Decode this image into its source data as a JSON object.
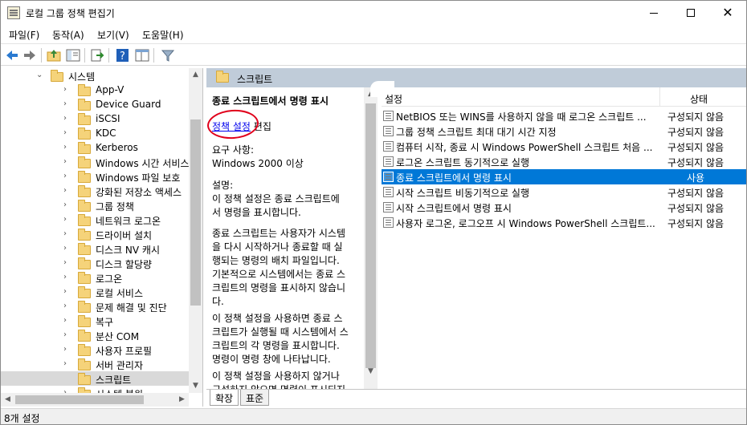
{
  "window": {
    "title": "로컬 그룹 정책 편집기",
    "min_glyph": "",
    "max_glyph": "",
    "close_glyph": "✕"
  },
  "menu": {
    "items": [
      "파일(F)",
      "동작(A)",
      "보기(V)",
      "도움말(H)"
    ]
  },
  "toolbar": {
    "buttons": [
      "back-arrow-icon",
      "forward-arrow-icon",
      "up-folder-icon",
      "show-hide-tree-icon",
      "export-list-icon",
      "help-icon",
      "show-pane-icon",
      "filter-icon"
    ]
  },
  "tree": {
    "items": [
      {
        "label": "시스템",
        "expanded": true
      },
      {
        "label": "App-V"
      },
      {
        "label": "Device Guard"
      },
      {
        "label": "iSCSI"
      },
      {
        "label": "KDC"
      },
      {
        "label": "Kerberos"
      },
      {
        "label": "Windows 시간 서비스"
      },
      {
        "label": "Windows 파일 보호"
      },
      {
        "label": "강화된 저장소 액세스"
      },
      {
        "label": "그룹 정책"
      },
      {
        "label": "네트워크 로그온"
      },
      {
        "label": "드라이버 설치"
      },
      {
        "label": "디스크 NV 캐시"
      },
      {
        "label": "디스크 할당량"
      },
      {
        "label": "로그온"
      },
      {
        "label": "로컬 서비스"
      },
      {
        "label": "문제 해결 및 진단"
      },
      {
        "label": "복구"
      },
      {
        "label": "분산 COM"
      },
      {
        "label": "사용자 프로필"
      },
      {
        "label": "서버 관리자"
      },
      {
        "label": "스크립트",
        "selected": true
      },
      {
        "label": "시스템 복원"
      }
    ]
  },
  "section": {
    "title": "스크립트"
  },
  "description": {
    "heading": "종료 스크립트에서 명령 표시",
    "link": "정책 설정",
    "link_suffix": " 편집",
    "requirements": "요구 사항:\nWindows 2000 이상",
    "desc1": "설명:\n이 정책 설정은 종료 스크립트에\n서 명령을 표시합니다.",
    "desc2": "종료 스크립트는 사용자가 시스템\n을 다시 시작하거나 종료할 때 실\n행되는 명령의 배치 파일입니다.\n기본적으로 시스템에서는 종료 스\n크립트의 명령을 표시하지 않습니\n다.",
    "desc3": "이 정책 설정을 사용하면 종료 스\n크립트가 실행될 때 시스템에서 스\n크립트의 각 명령을 표시합니다.\n명령이 명령 창에 나타납니다.",
    "desc4": "이 정책 설정을 사용하지 않거나\n구성하지 않으면 명령이 표시되지"
  },
  "list": {
    "col_setting": "설정",
    "col_state": "상태",
    "rows": [
      {
        "name": "NetBIOS 또는 WINS를 사용하지 않을 때 로그온 스크립트 ...",
        "state": "구성되지 않음"
      },
      {
        "name": "그룹 정책 스크립트 최대 대기 시간 지정",
        "state": "구성되지 않음"
      },
      {
        "name": "컴퓨터 시작, 종료 시 Windows PowerShell 스크립트 처음 ...",
        "state": "구성되지 않음"
      },
      {
        "name": "로그온 스크립트 동기적으로 실행",
        "state": "구성되지 않음"
      },
      {
        "name": "종료 스크립트에서 명령 표시",
        "state": "사용",
        "selected": true
      },
      {
        "name": "시작 스크립트 비동기적으로 실행",
        "state": "구성되지 않음"
      },
      {
        "name": "시작 스크립트에서 명령 표시",
        "state": "구성되지 않음"
      },
      {
        "name": "사용자 로그온, 로그오프 시 Windows PowerShell 스크립트...",
        "state": "구성되지 않음"
      }
    ]
  },
  "tabs": [
    "확장",
    "표준"
  ],
  "status": {
    "text": "8개 설정"
  }
}
